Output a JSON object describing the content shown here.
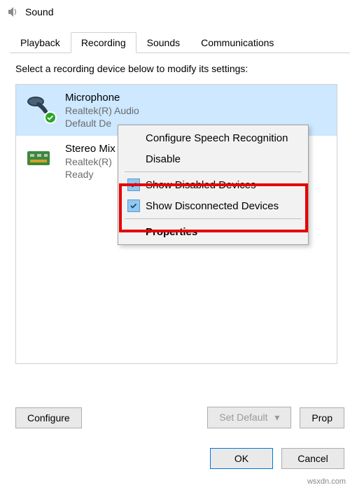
{
  "window": {
    "title": "Sound"
  },
  "tabs": {
    "playback": "Playback",
    "recording": "Recording",
    "sounds": "Sounds",
    "communications": "Communications"
  },
  "instruction": "Select a recording device below to modify its settings:",
  "devices": [
    {
      "name": "Microphone",
      "driver": "Realtek(R) Audio",
      "status": "Default De"
    },
    {
      "name": "Stereo Mix",
      "driver": "Realtek(R)",
      "status": "Ready"
    }
  ],
  "context_menu": {
    "configure_speech": "Configure Speech Recognition",
    "disable": "Disable",
    "show_disabled": "Show Disabled Devices",
    "show_disconnected": "Show Disconnected Devices",
    "properties": "Properties"
  },
  "buttons": {
    "configure": "Configure",
    "set_default": "Set Default",
    "properties_short": "Prop",
    "ok": "OK",
    "cancel": "Cancel"
  },
  "watermark": "wsxdn.com"
}
